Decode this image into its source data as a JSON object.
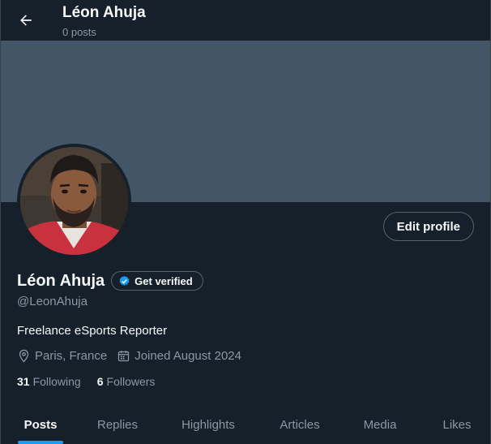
{
  "header": {
    "title": "Léon Ahuja",
    "post_count": "0 posts"
  },
  "profile": {
    "display_name": "Léon Ahuja",
    "handle": "@LeonAhuja",
    "bio": "Freelance eSports Reporter",
    "location": "Paris, France",
    "joined": "Joined August 2024",
    "following_count": "31",
    "following_label": "Following",
    "followers_count": "6",
    "followers_label": "Followers"
  },
  "buttons": {
    "edit_profile": "Edit profile",
    "get_verified": "Get verified"
  },
  "tabs": [
    {
      "label": "Posts",
      "active": true
    },
    {
      "label": "Replies"
    },
    {
      "label": "Highlights"
    },
    {
      "label": "Articles"
    },
    {
      "label": "Media"
    },
    {
      "label": "Likes"
    }
  ],
  "colors": {
    "background": "#15202b",
    "banner": "#435566",
    "accent": "#1d9bf0",
    "secondary_text": "#8b98a5"
  },
  "icons": {
    "back": "arrow-left-icon",
    "verified": "verified-badge-icon",
    "location": "location-pin-icon",
    "calendar": "calendar-icon"
  }
}
